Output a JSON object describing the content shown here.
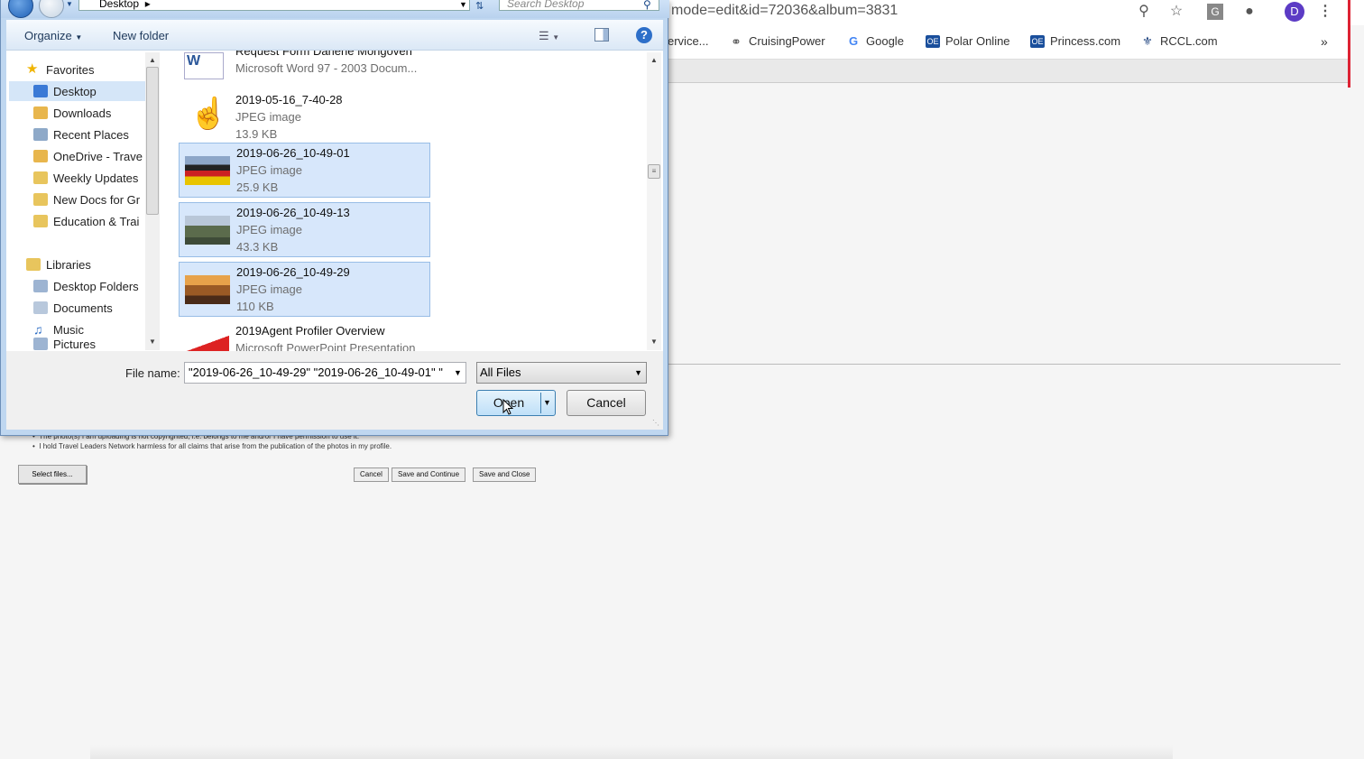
{
  "browser": {
    "url": "mode=edit&id=72036&album=3831",
    "avatar_letter": "D",
    "ext_letter": "G",
    "bookmarks": [
      {
        "label": "ervice...",
        "icon": ""
      },
      {
        "label": "CruisingPower",
        "icon": "globe-icon"
      },
      {
        "label": "Google",
        "icon": "google-icon"
      },
      {
        "label": "Polar Online",
        "icon": "polar-icon"
      },
      {
        "label": "Princess.com",
        "icon": "princess-icon"
      },
      {
        "label": "RCCL.com",
        "icon": "rccl-icon"
      }
    ],
    "more_bookmarks": "»"
  },
  "webpage": {
    "note_1": "The photo(s) I am uploading is not copyrighted, i.e. belongs to me and/or I have permission to use it.",
    "note_2": "I hold Travel Leaders Network harmless for all claims that arise from the publication of the photos in my profile.",
    "select_files": "Select files...",
    "cancel": "Cancel",
    "save_continue": "Save and Continue",
    "save_close": "Save and Close"
  },
  "dialog": {
    "breadcrumb": "Desktop",
    "search_placeholder": "Search Desktop",
    "organize": "Organize",
    "new_folder": "New folder",
    "help": "?",
    "nav": {
      "favorites": "Favorites",
      "favorites_items": [
        "Desktop",
        "Downloads",
        "Recent Places",
        "OneDrive - Trave",
        "Weekly Updates",
        "New Docs for Gr",
        "Education & Trai"
      ],
      "libraries": "Libraries",
      "libraries_items": [
        "Desktop Folders",
        "Documents",
        "Music",
        "Pictures"
      ]
    },
    "files": [
      {
        "name": "Request Form Darlene Mongoven",
        "type": "Microsoft Word 97 - 2003 Docum...",
        "size": ""
      },
      {
        "name": "2019-05-16_7-40-28",
        "type": "JPEG image",
        "size": "13.9 KB"
      },
      {
        "name": "2019-06-26_10-49-01",
        "type": "JPEG image",
        "size": "25.9 KB"
      },
      {
        "name": "2019-06-26_10-49-13",
        "type": "JPEG image",
        "size": "43.3 KB"
      },
      {
        "name": "2019-06-26_10-49-29",
        "type": "JPEG image",
        "size": "110 KB"
      },
      {
        "name": "2019Agent Profiler Overview",
        "type": "Microsoft PowerPoint Presentation",
        "size": ""
      }
    ],
    "file_name_label": "File name:",
    "file_name_value": "\"2019-06-26_10-49-29\" \"2019-06-26_10-49-01\" \"",
    "filter": "All Files",
    "open": "Open",
    "cancel": "Cancel"
  }
}
